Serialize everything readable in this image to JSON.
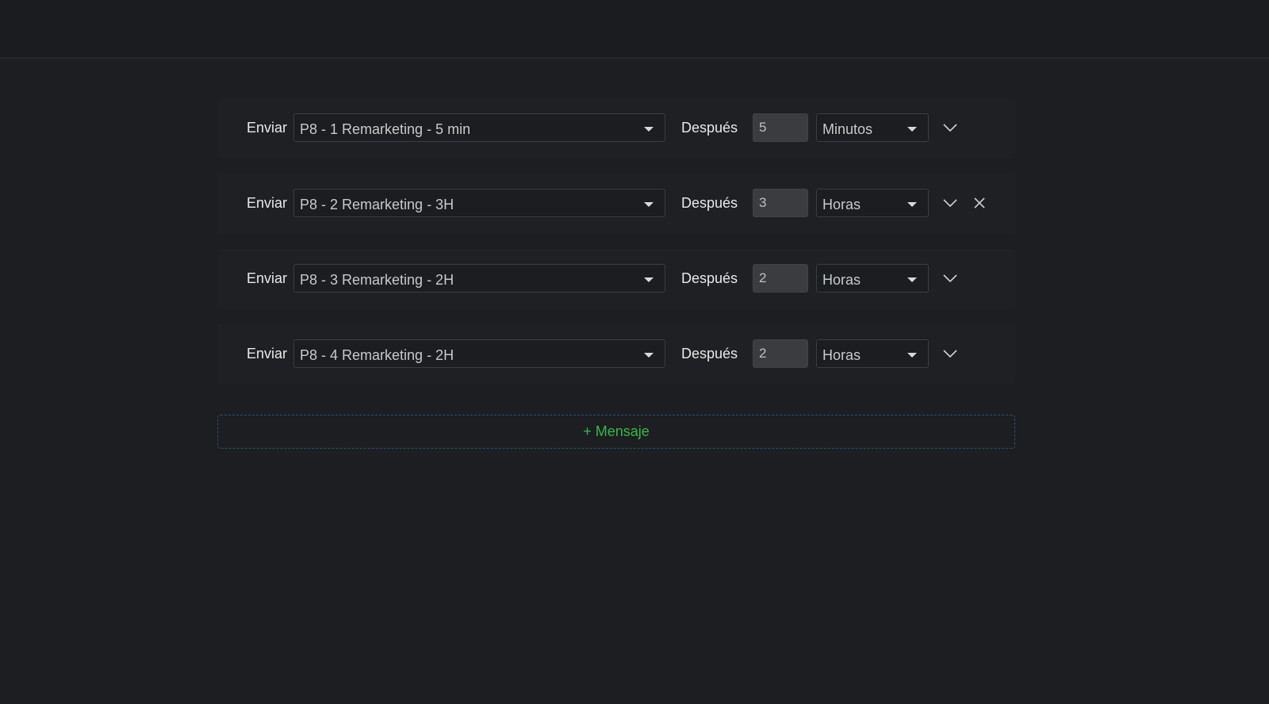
{
  "labels": {
    "send": "Enviar",
    "after": "Después"
  },
  "rows": [
    {
      "template": "P8 - 1 Remarketing - 5 min",
      "amount": "5",
      "unit": "Minutos",
      "removable": false
    },
    {
      "template": "P8 - 2 Remarketing - 3H",
      "amount": "3",
      "unit": "Horas",
      "removable": true
    },
    {
      "template": "P8 - 3 Remarketing - 2H",
      "amount": "2",
      "unit": "Horas",
      "removable": false
    },
    {
      "template": "P8 - 4 Remarketing - 2H",
      "amount": "2",
      "unit": "Horas",
      "removable": false
    }
  ],
  "add_button": {
    "label": "+ Mensaje"
  },
  "icons": {
    "dropdown": "caret-down-icon",
    "expand": "chevron-down-icon",
    "remove": "close-icon"
  },
  "colors": {
    "background": "#1d1e21",
    "accent_green": "#35b84a",
    "dashed_border": "#2c4e78"
  }
}
